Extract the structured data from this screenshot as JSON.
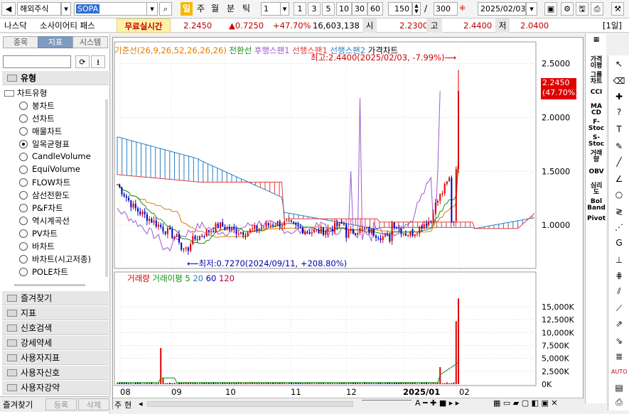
{
  "toolbar": {
    "market": "해외주식",
    "symbol": "SOPA",
    "periods": [
      "일",
      "주",
      "월",
      "분",
      "틱"
    ],
    "active_period": "일",
    "interval_value": "1",
    "quick_intervals": [
      "1",
      "3",
      "5",
      "10",
      "30",
      "60"
    ],
    "count_value": "150",
    "separator": "/",
    "count_total": "300",
    "date": "2025/02/03"
  },
  "info": {
    "exchange": "나스닥",
    "name": "소사이어티 패스",
    "realtime_label": "무료실시간",
    "price": "2.2450",
    "change": "▲0.7250",
    "change_pct": "+47.70%",
    "volume": "16,603,138",
    "open_label": "시",
    "open": "2.2300",
    "high_label": "고",
    "high": "2.4400",
    "low_label": "저",
    "low": "2.0400",
    "period_badge": "[1일]"
  },
  "left": {
    "tabs": [
      "종목",
      "지표",
      "시스템"
    ],
    "active_tab": "지표",
    "section": "유형",
    "group": "차트유형",
    "items": [
      "봉차트",
      "선차트",
      "매물차트",
      "일목균형표",
      "CandleVolume",
      "EquiVolume",
      "FLOW차트",
      "삼선전환도",
      "P&F차트",
      "역시계곡선",
      "PV차트",
      "바차트",
      "바차트(시고저종)",
      "POLE차트"
    ],
    "selected_item": "일목균형표",
    "folders": [
      "즐겨찾기",
      "지표",
      "신호검색",
      "강세약세",
      "사용자지표",
      "사용자신호",
      "사용자강약"
    ],
    "bottom_tabs": [
      "즐겨찾기",
      "등록",
      "삭제"
    ]
  },
  "chart": {
    "legend_price": [
      "기준선(26,9,26,52,26,26,26)",
      "전환선",
      "후행스팬1",
      "선행스팬1",
      "선행스팬2",
      "가격차트"
    ],
    "legend_volume": [
      "거래량",
      "거래이평 5",
      "20",
      "60",
      "120"
    ],
    "high_note": "최고:2.4400(2025/02/03, -7.99%)",
    "low_note": "최저:0.7270(2024/09/11, +208.80%)",
    "price_ticks": [
      "2.5000",
      "2.0000",
      "1.5000",
      "1.0000"
    ],
    "current_price": "2.2450",
    "current_pct": "(47.70%)",
    "volume_ticks": [
      "15,000K",
      "12,500K",
      "10,000K",
      "7,500K",
      "5,000K",
      "2,500K",
      "0K"
    ],
    "x_ticks": [
      "08",
      "09",
      "10",
      "11",
      "12",
      "2025/01",
      "02"
    ],
    "nav": [
      "주",
      "현"
    ]
  },
  "right_tools": [
    "가격\n이평",
    "그룹\n차트",
    "CCI",
    "MA\nCD",
    "F-\nStoc",
    "S-\nStoc",
    "거래\n량",
    "OBV",
    "심리\n도",
    "Bol\nBand",
    "Pivot"
  ],
  "colors": {
    "kijun": "#e07b00",
    "tenkan": "#109010",
    "chikou": "#9b59d0",
    "senkou1": "#e23c3c",
    "senkou2": "#2b7fc0",
    "up": "#e00000",
    "down": "#0000c0",
    "price_badge": "#e00000"
  },
  "chart_data": {
    "type": "candlestick_ichimoku",
    "ylim": [
      0.6,
      2.7
    ],
    "high": 2.44,
    "high_date": "2025/02/03",
    "low": 0.727,
    "low_date": "2024/09/11",
    "last": 2.245,
    "volume_ylim": [
      0,
      16500
    ],
    "volume_unit": "K"
  }
}
